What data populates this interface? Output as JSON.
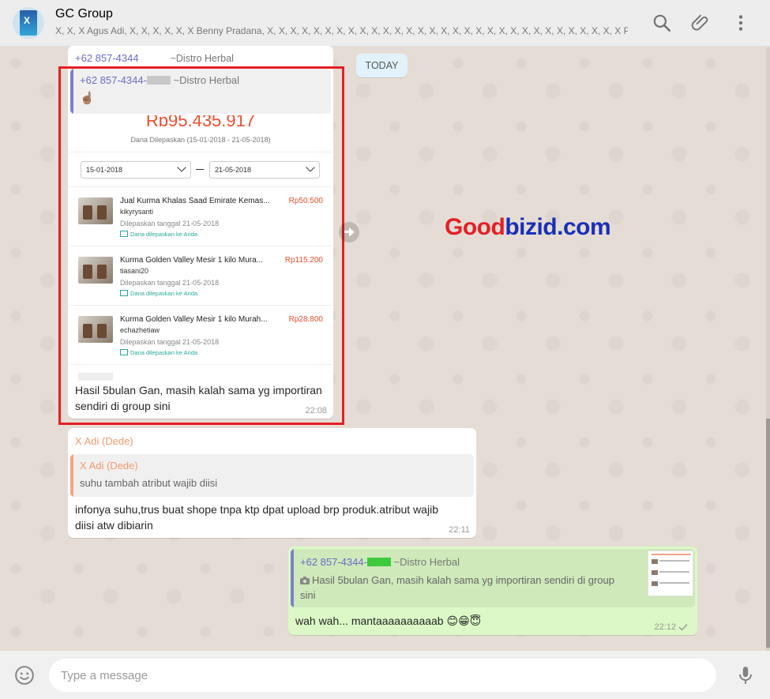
{
  "header": {
    "title": "GC Group",
    "members": "X, X, X Agus Adi, X, X, X, X, X, X Benny Pradana, X, X, X, X, X, X, X, X, X, X, X, X, X, X, X, X, X, X, X, X, X, X, X, X, X, X, X, X, X, X, X Phang ..."
  },
  "date_chip": "TODAY",
  "messages": {
    "m1": {
      "sender": "+62 857-4344",
      "sender_suffix": "~Distro Herbal",
      "quote_name": "+62 857-4344-",
      "quote_suffix": "~Distro Herbal",
      "quote_text": "☝🏽",
      "text_line1": "Hasil 5bulan Gan, masih kalah sama yg importiran",
      "text_line2": "sendiri di group sini",
      "time": "22:08"
    },
    "m2": {
      "sender": "X Adi (Dede)",
      "quote_name": "X Adi (Dede)",
      "quote_text": "suhu tambah atribut wajib diisi",
      "text_line1": "infonya suhu,trus buat shope tnpa ktp dpat upload brp produk.atribut wajib",
      "text_line2": "diisi atw dibiarin",
      "time": "22:11"
    },
    "m3": {
      "quote_name": "+62 857-4344-",
      "quote_suffix": "~Distro Herbal",
      "quote_line1": "Hasil 5bulan Gan, masih kalah sama yg importiran sendiri di group",
      "quote_line2": "sini",
      "text": "wah wah... mantaaaaaaaaaab 😊😁😇",
      "time": "22:12"
    }
  },
  "screenshot": {
    "amount": "Rp95.435.917",
    "amount_label": "Dana Dilepaskan (15-01-2018 - 21-05-2018)",
    "date_from": "15-01-2018",
    "date_to": "21-05-2018",
    "products": [
      {
        "name": "Jual Kurma Khalas Saad Emirate Kemas...",
        "price": "Rp50.500",
        "seller": "kikyrysanti",
        "date": "Dilepaskan tanggal 21-05-2018",
        "note": "Dana dilepaskan ke Anda"
      },
      {
        "name": "Kurma Golden Valley Mesir 1 kilo Mura...",
        "price": "Rp115.200",
        "seller": "tiasani20",
        "date": "Dilepaskan tanggal 21-05-2018",
        "note": "Dana dilepaskan ke Anda"
      },
      {
        "name": "Kurma Golden Valley Mesir 1 kilo Murah...",
        "price": "Rp28.800",
        "seller": "echazhetiaw",
        "date": "Dilepaskan tanggal 21-05-2018",
        "note": "Dana dilepaskan ke Anda"
      }
    ]
  },
  "watermark": {
    "part1": "Good",
    "part2": "bizid.com",
    "color1": "#e41f26",
    "color2": "#1a2fb8"
  },
  "composer": {
    "placeholder": "Type a message"
  },
  "colors": {
    "accent_green": "#dcf8c6",
    "red_box": "#e41f26",
    "quote_purple": "#7f7fc9",
    "quote_orange": "#f5a37f",
    "sender_orange": "#f09a6f",
    "sender_purple": "#6b6bc9"
  },
  "icons": {
    "search": "search-icon",
    "attach": "paperclip-icon",
    "menu": "more-vert-icon",
    "emoji": "emoji-icon",
    "mic": "mic-icon",
    "forward": "forward-icon",
    "check": "check-icon",
    "camera": "camera-icon"
  }
}
